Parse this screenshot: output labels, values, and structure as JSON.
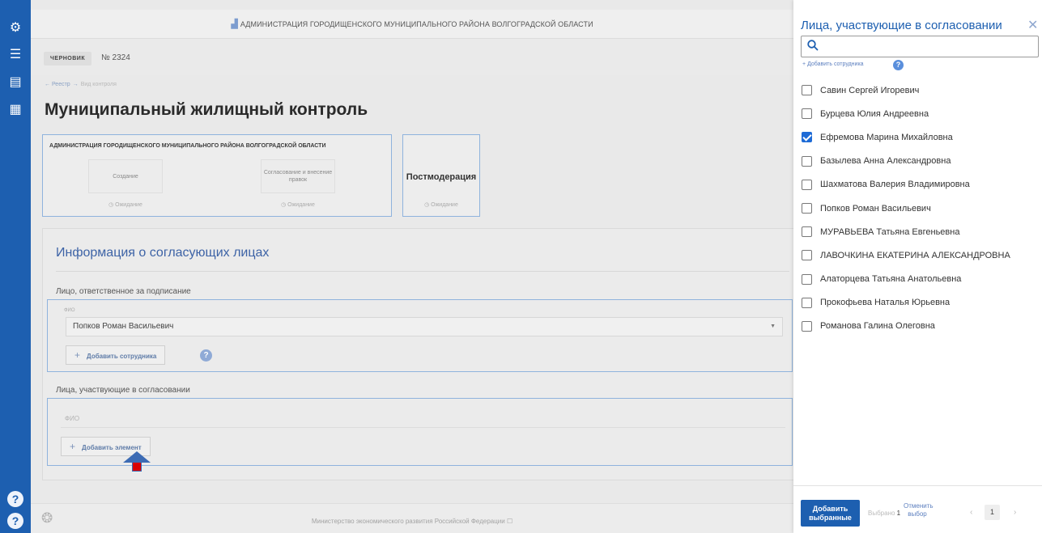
{
  "header": {
    "org_title": "АДМИНИСТРАЦИЯ ГОРОДИЩЕНСКОГО МУНИЦИПАЛЬНОГО РАЙОНА ВОЛГОГРАДСКОЙ ОБЛАСТИ"
  },
  "document": {
    "status_badge": "ЧЕРНОВИК",
    "number": "№ 2324"
  },
  "breadcrumb": {
    "registry": "← Реестр",
    "separator": "→",
    "current": "Вид контроля"
  },
  "page_title": "Муниципальный жилищный контроль",
  "stages": {
    "org_title": "АДМИНИСТРАЦИЯ ГОРОДИЩЕНСКОГО МУНИЦИПАЛЬНОГО РАЙОНА ВОЛГОГРАДСКОЙ ОБЛАСТИ",
    "items": [
      {
        "label": "Создание",
        "status": "◷ Ожидание"
      },
      {
        "label": "Согласование и внесение правок",
        "status": "◷ Ожидание"
      }
    ],
    "postmoderation": {
      "label": "Постмодерация",
      "status": "◷ Ожидание"
    }
  },
  "approvers_card": {
    "title": "Информация о согласующих лицах",
    "signer_label": "Лицо, ответственное за подписание",
    "signer_fio_label": "ФИО",
    "signer_value": "Попков Роман Васильевич",
    "add_employee_label": "Добавить сотрудника",
    "participants_label": "Лица, участвующие в согласовании",
    "participants_fio_header": "ФИО",
    "add_element_label": "Добавить элемент"
  },
  "footer": {
    "text": "Министерство экономического развития Российской Федерации ☐"
  },
  "panel": {
    "title": "Лица, участвующие в согласовании",
    "search_placeholder": "",
    "add_employee_label": "Добавить сотрудника",
    "items": [
      {
        "label": "Савин Сергей Игоревич",
        "checked": false
      },
      {
        "label": "Бурцева Юлия Андреевна",
        "checked": false
      },
      {
        "label": "Ефремова Марина Михайловна",
        "checked": true
      },
      {
        "label": "Базылева Анна Александровна",
        "checked": false
      },
      {
        "label": "Шахматова Валерия Владимировна",
        "checked": false
      },
      {
        "label": "Попков Роман Васильевич",
        "checked": false
      },
      {
        "label": "МУРАВЬЕВА Татьяна Евгеньевна",
        "checked": false
      },
      {
        "label": "ЛАВОЧКИНА ЕКАТЕРИНА АЛЕКСАНДРОВНА",
        "checked": false
      },
      {
        "label": "Алаторцева Татьяна Анатольевна",
        "checked": false
      },
      {
        "label": "Прокофьева Наталья Юрьевна",
        "checked": false
      },
      {
        "label": "Романова Галина Олеговна",
        "checked": false
      }
    ],
    "footer": {
      "add_selected_label": "Добавить выбранные",
      "selected_text": "Выбрано",
      "selected_count": "1",
      "cancel_selection_label": "Отменить выбор",
      "page": "1"
    }
  },
  "colors": {
    "brand": "#1d5fb0",
    "checkbox_checked": "#1e6bd6",
    "pointer_arrow": "#d90000"
  }
}
